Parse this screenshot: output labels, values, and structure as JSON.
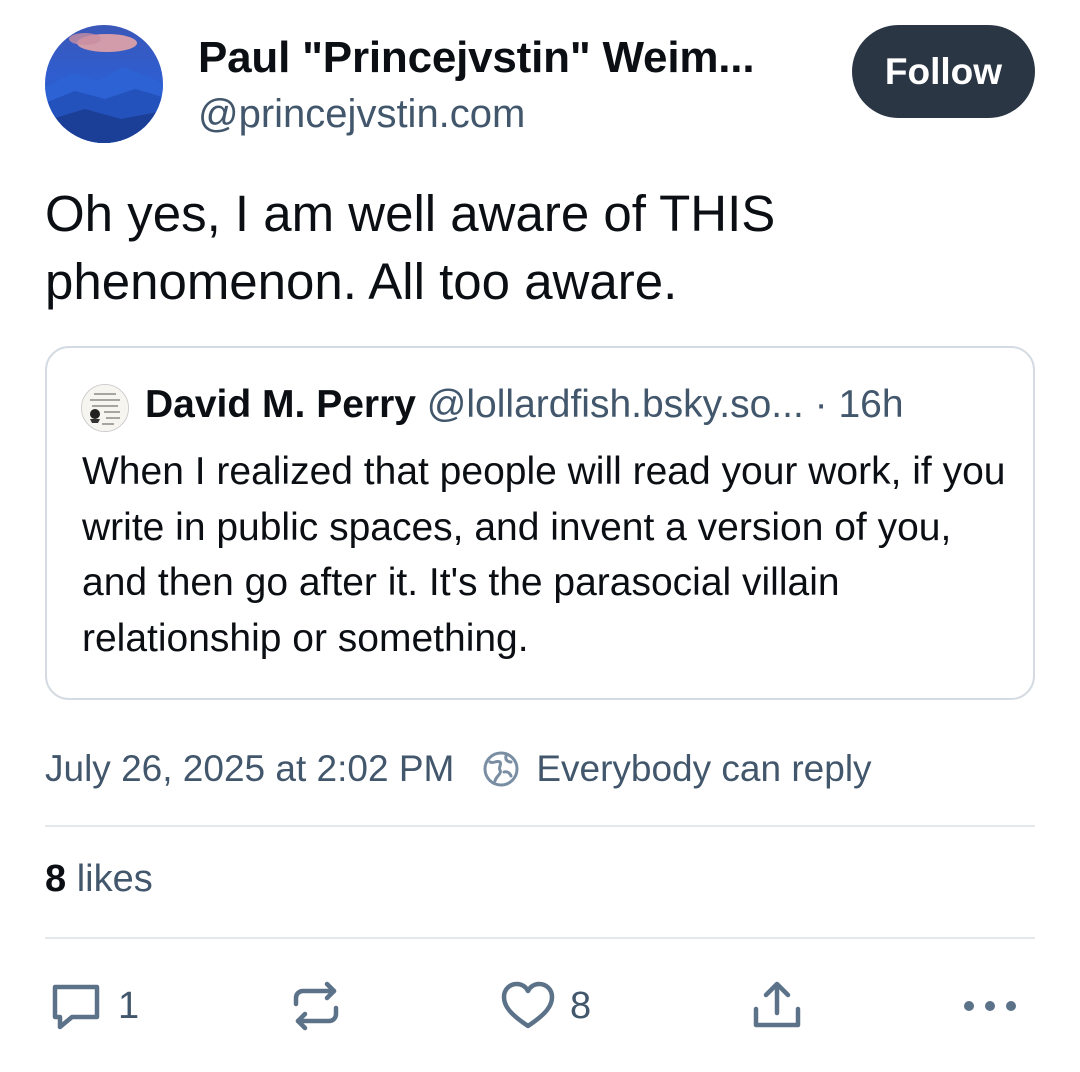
{
  "author": {
    "display_name": "Paul \"Princejvstin\" Weim...",
    "handle": "@princejvstin.com",
    "avatar_icon": "mountain-landscape-avatar"
  },
  "follow_button": {
    "label": "Follow"
  },
  "post": {
    "text": "Oh yes, I am well aware of THIS phenomenon. All too aware."
  },
  "quote": {
    "avatar_icon": "handwritten-note-avatar",
    "author_name": "David M. Perry",
    "handle": "@lollardfish.bsky.so...",
    "time": " · 16h",
    "text": "When I realized that people will read your work, if you write in public spaces, and invent a version of you, and then go after it. It's the parasocial villain relationship or something."
  },
  "meta": {
    "date": "July 26, 2025 at 2:02 PM",
    "reply_setting": "Everybody can reply",
    "reply_icon": "globe-reply-icon"
  },
  "likes": {
    "count": "8",
    "label": " likes"
  },
  "actions": {
    "reply_count": "1",
    "repost_count": "",
    "like_count": "8"
  },
  "colors": {
    "text_primary": "#0b0f14",
    "text_secondary": "#42576c",
    "follow_bg": "#2b3645",
    "border": "#d4dbe2",
    "icon": "#5b7289"
  }
}
